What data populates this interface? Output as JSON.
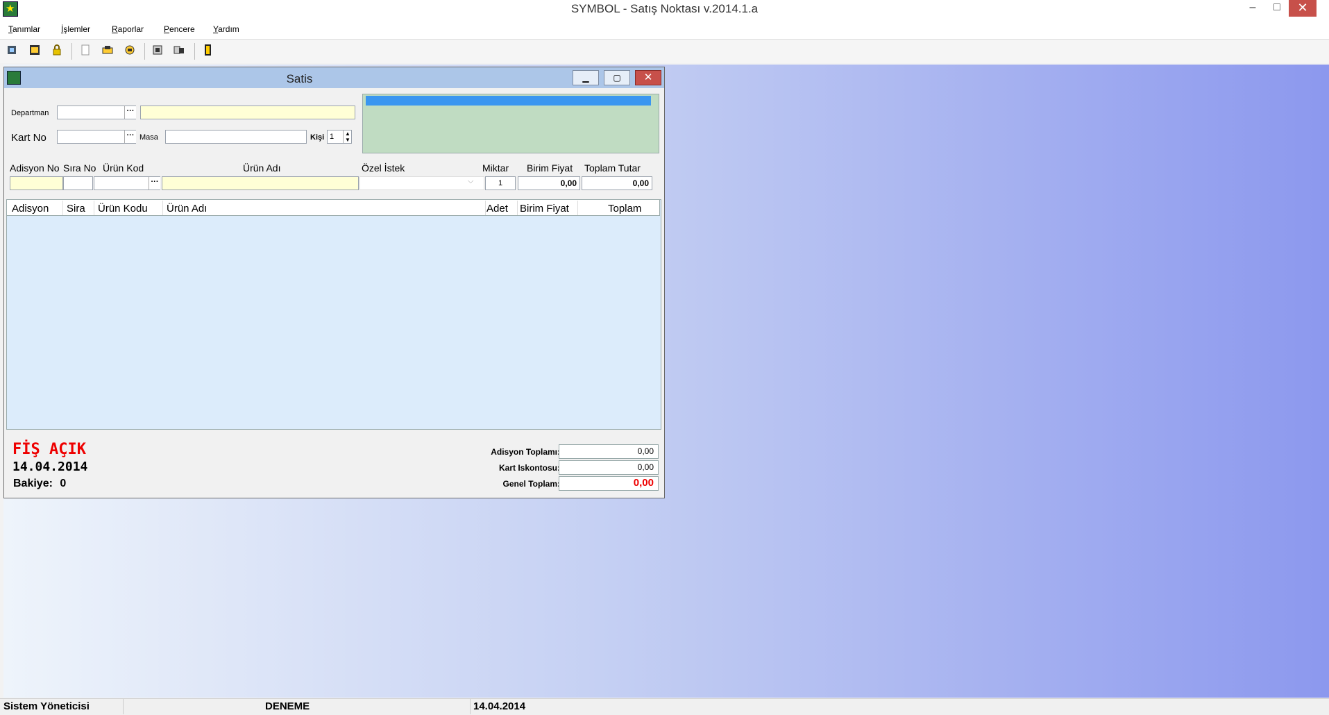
{
  "app": {
    "title": "SYMBOL - Satış Noktası  v.2014.1.a"
  },
  "window_controls": {
    "minimize": "–",
    "maximize": "□",
    "close": "✕"
  },
  "menu": [
    "Tanımlar",
    "İşlemler",
    "Raporlar",
    "Pencere",
    "Yardım"
  ],
  "toolbar": {
    "icons": [
      "tool-icon-1",
      "tool-icon-2",
      "lock-icon",
      "page-icon",
      "tool-icon-5",
      "tool-icon-6",
      "tool-icon-7",
      "tool-icon-8",
      "exit-door-icon"
    ]
  },
  "satis": {
    "title": "Satis",
    "controls": {
      "minimize": "▁",
      "maximize": "▢",
      "close": "✕"
    },
    "departman_label": "Departman",
    "kart_no_label": "Kart No",
    "masa_label": "Masa",
    "kisi_label": "Kişi",
    "kisi_value": "1",
    "dots": "···",
    "entry_headers": {
      "adisyon_no": "Adisyon No",
      "sira_no": "Sıra No",
      "urun_kod": "Ürün Kod",
      "urun_adi": "Ürün Adı",
      "ozel_istek": "Özel İstek",
      "miktar": "Miktar",
      "birim_fiyat": "Birim Fiyat",
      "toplam_tutar": "Toplam Tutar"
    },
    "entry_values": {
      "miktar": "1",
      "birim_fiyat": "0,00",
      "toplam_tutar": "0,00"
    },
    "grid_headers": [
      "Adisyon",
      "Sira",
      "Ürün Kodu",
      "Ürün Adı",
      "Adet",
      "Birim Fiyat",
      "Toplam"
    ],
    "status_text": "FİŞ AÇIK",
    "date": "14.04.2014",
    "bakiye_label": "Bakiye:",
    "bakiye_value": "0",
    "totals": {
      "adisyon_toplami_label": "Adisyon Toplamı:",
      "adisyon_toplami": "0,00",
      "kart_iskontosu_label": "Kart Iskontosu:",
      "kart_iskontosu": "0,00",
      "genel_toplam_label": "Genel Toplam:",
      "genel_toplam": "0,00"
    }
  },
  "statusbar": {
    "user": "Sistem Yöneticisi",
    "company": "DENEME",
    "date": "14.04.2014"
  },
  "colors": {
    "accent_red": "#e00000",
    "title_blue": "#acc6e8",
    "panel_green": "#c0dcc2",
    "yellow_input": "#ffffd6"
  }
}
